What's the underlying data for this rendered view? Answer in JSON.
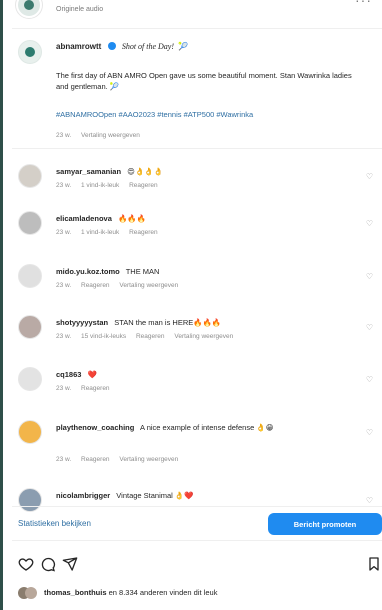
{
  "header": {
    "sub": "Originele audio",
    "more_icon": "ellipsis-icon"
  },
  "post": {
    "username": "abnamrowtt",
    "verified_icon": "verified-check-icon",
    "title": "Shot of the Day!",
    "text": "The first day of ABN AMRO Open gave us some beautiful moment. Stan Wawrinka ladies and gentleman. 🎾",
    "hashtags": "#ABNAMROOpen #AAO2023 #tennis #ATP500 #Wawrinka",
    "meta": {
      "time": "23 w.",
      "translate": "Vertaling weergeven"
    }
  },
  "comments": [
    {
      "user": "samyar_samanian",
      "text": "😍👌👌👌",
      "meta": [
        "23 w.",
        "1 vind-ik-leuk",
        "Reageren"
      ]
    },
    {
      "user": "elicamladenova",
      "text": "🔥🔥🔥",
      "meta": [
        "23 w.",
        "1 vind-ik-leuk",
        "Reageren"
      ]
    },
    {
      "user": "mido.yu.koz.tomo",
      "text": "THE MAN",
      "meta": [
        "23 w.",
        "Reageren",
        "Vertaling weergeven"
      ]
    },
    {
      "user": "shotyyyyystan",
      "text": "STAN the man is HERE🔥🔥🔥",
      "meta": [
        "23 w.",
        "15 vind-ik-leuks",
        "Reageren",
        "Vertaling weergeven"
      ]
    },
    {
      "user": "cq1863",
      "text": "❤️",
      "meta": [
        "23 w.",
        "Reageren"
      ]
    },
    {
      "user": "playthenow_coaching",
      "text": "A nice example of intense defense 👌😁",
      "meta": [
        "23 w.",
        "Reageren",
        "Vertaling weergeven"
      ]
    },
    {
      "user": "nicolambrigger",
      "text": "Vintage Stanimal 👌❤️",
      "meta": []
    }
  ],
  "footer": {
    "stats": "Statistieken bekijken",
    "promote": "Bericht promoten"
  },
  "likes": {
    "user": "thomas_bonthuis",
    "text": "en 8.334 anderen vinden dit leuk"
  },
  "colors": {
    "accent": "#1f8bf0",
    "link": "#2f6fa3",
    "muted": "#8e8e8e"
  }
}
